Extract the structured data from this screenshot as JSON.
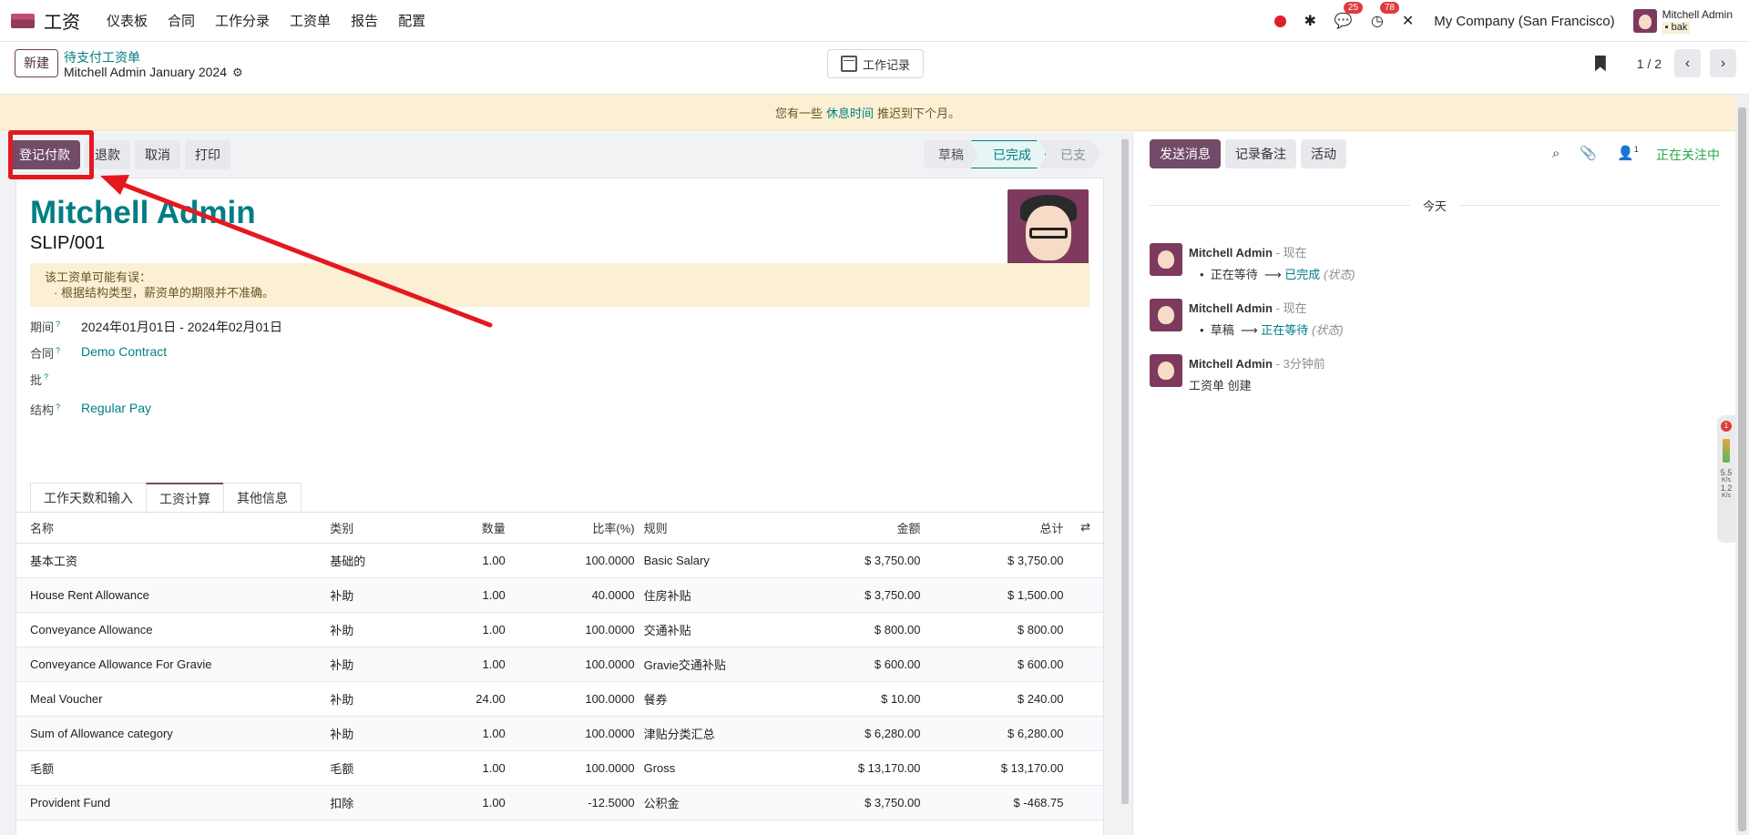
{
  "nav": {
    "app_name": "工资",
    "menu": [
      "仪表板",
      "合同",
      "工作分录",
      "工资单",
      "报告",
      "配置"
    ],
    "chat_count": "25",
    "activity_count": "78",
    "company": "My Company (San Francisco)",
    "user_name": "Mitchell Admin",
    "db_name": "bak"
  },
  "control": {
    "new_label": "新建",
    "breadcrumb": "待支付工资单",
    "record_name": "Mitchell Admin January 2024",
    "worklog_label": "工作记录",
    "pager": "1 / 2"
  },
  "banner": {
    "before": "您有一些",
    "link": "休息时间",
    "after": "推迟到下个月。"
  },
  "actions": {
    "register_payment": "登记付款",
    "refund": "退款",
    "cancel": "取消",
    "print": "打印"
  },
  "stages": [
    "草稿",
    "已完成",
    "已支"
  ],
  "form": {
    "employee": "Mitchell Admin",
    "slip_number": "SLIP/001",
    "alert_title": "该工资单可能有误：",
    "alert_item": "· 根据结构类型，薪资单的期限并不准确。",
    "period_label": "期间",
    "period_value": "2024年01月01日 - 2024年02月01日",
    "contract_label": "合同",
    "contract_value": "Demo Contract",
    "batch_label": "批",
    "structure_label": "结构",
    "structure_value": "Regular Pay",
    "help_mark": "?"
  },
  "tabs": [
    "工作天数和输入",
    "工资计算",
    "其他信息"
  ],
  "table": {
    "headers": {
      "name": "名称",
      "category": "类别",
      "qty": "数量",
      "rate": "比率(%)",
      "rule": "规则",
      "amount": "金额",
      "total": "总计"
    },
    "rows": [
      {
        "name": "基本工资",
        "category": "基础的",
        "qty": "1.00",
        "rate": "100.0000",
        "rule": "Basic Salary",
        "amount": "$ 3,750.00",
        "total": "$ 3,750.00"
      },
      {
        "name": "House Rent Allowance",
        "category": "补助",
        "qty": "1.00",
        "rate": "40.0000",
        "rule": "住房补贴",
        "amount": "$ 3,750.00",
        "total": "$ 1,500.00"
      },
      {
        "name": "Conveyance Allowance",
        "category": "补助",
        "qty": "1.00",
        "rate": "100.0000",
        "rule": "交通补贴",
        "amount": "$ 800.00",
        "total": "$ 800.00"
      },
      {
        "name": "Conveyance Allowance For Gravie",
        "category": "补助",
        "qty": "1.00",
        "rate": "100.0000",
        "rule": "Gravie交通补贴",
        "amount": "$ 600.00",
        "total": "$ 600.00"
      },
      {
        "name": "Meal Voucher",
        "category": "补助",
        "qty": "24.00",
        "rate": "100.0000",
        "rule": "餐券",
        "amount": "$ 10.00",
        "total": "$ 240.00"
      },
      {
        "name": "Sum of Allowance category",
        "category": "补助",
        "qty": "1.00",
        "rate": "100.0000",
        "rule": "津贴分类汇总",
        "amount": "$ 6,280.00",
        "total": "$ 6,280.00"
      },
      {
        "name": "毛额",
        "category": "毛额",
        "qty": "1.00",
        "rate": "100.0000",
        "rule": "Gross",
        "amount": "$ 13,170.00",
        "total": "$ 13,170.00"
      },
      {
        "name": "Provident Fund",
        "category": "扣除",
        "qty": "1.00",
        "rate": "-12.5000",
        "rule": "公积金",
        "amount": "$ 3,750.00",
        "total": "$ -468.75"
      }
    ]
  },
  "chatter": {
    "send_message": "发送消息",
    "log_note": "记录备注",
    "activity": "活动",
    "follower_count": "1",
    "following": "正在关注中",
    "today": "今天",
    "messages": [
      {
        "author": "Mitchell Admin",
        "time": "- 现在",
        "old": "正在等待",
        "new": "已完成",
        "field": "(状态)"
      },
      {
        "author": "Mitchell Admin",
        "time": "- 现在",
        "old": "草稿",
        "new": "正在等待",
        "field": "(状态)"
      },
      {
        "author": "Mitchell Admin",
        "time": "- 3分钟前",
        "text": "工资单 创建"
      }
    ]
  },
  "widget": {
    "badge": "1",
    "up": "5.5",
    "down": "1.2",
    "unit": "K/s"
  },
  "colors": {
    "brand": "#714b67",
    "link": "#017e84",
    "annotation": "#e4181f"
  }
}
